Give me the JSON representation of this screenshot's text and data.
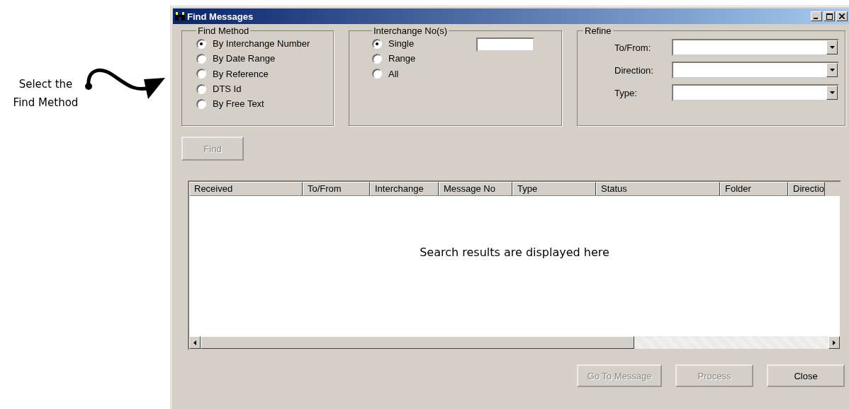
{
  "annotation": {
    "text": "Select the Find Method"
  },
  "window": {
    "title": "Find Messages"
  },
  "find_method": {
    "label": "Find Method",
    "options": [
      {
        "label": "By Interchange Number",
        "selected": true
      },
      {
        "label": "By Date Range",
        "selected": false
      },
      {
        "label": "By Reference",
        "selected": false
      },
      {
        "label": "DTS Id",
        "selected": false
      },
      {
        "label": "By Free Text",
        "selected": false
      }
    ]
  },
  "interchange": {
    "label": "Interchange No(s)",
    "options": [
      {
        "label": "Single",
        "selected": true
      },
      {
        "label": "Range",
        "selected": false
      },
      {
        "label": "All",
        "selected": false
      }
    ]
  },
  "refine": {
    "label": "Refine",
    "fields": [
      {
        "label": "To/From:"
      },
      {
        "label": "Direction:"
      },
      {
        "label": "Type:"
      }
    ]
  },
  "find_button": {
    "label": "Find",
    "disabled": true
  },
  "table": {
    "columns": [
      "Received",
      "To/From",
      "Interchange",
      "Message No",
      "Type",
      "Status",
      "Folder",
      "Directio"
    ],
    "empty_note": "Search results are displayed here"
  },
  "buttons": [
    {
      "label": "Go To Message",
      "disabled": true
    },
    {
      "label": "Process",
      "disabled": true
    },
    {
      "label": "Close",
      "disabled": false
    }
  ]
}
